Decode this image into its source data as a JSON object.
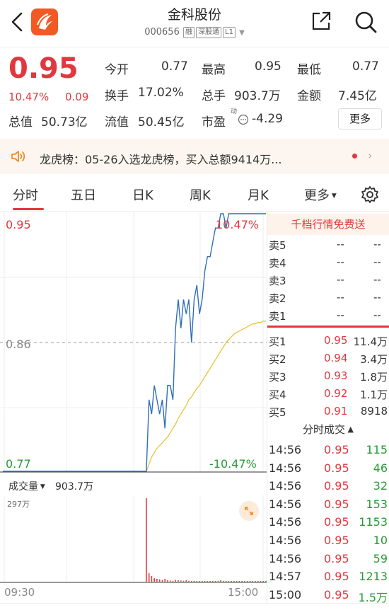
{
  "header": {
    "title": "金科股份",
    "code": "000656",
    "tags": [
      "融",
      "深股通",
      "L1"
    ]
  },
  "quote": {
    "price": "0.95",
    "change_pct": "10.47%",
    "change": "0.09",
    "fields": [
      {
        "label": "今开",
        "value": "0.77",
        "color": "green"
      },
      {
        "label": "最高",
        "value": "0.95",
        "color": "red"
      },
      {
        "label": "最低",
        "value": "0.77",
        "color": "green"
      },
      {
        "label": "换手",
        "value": "17.02%",
        "color": "black"
      },
      {
        "label": "总手",
        "value": "903.7万",
        "color": "black"
      },
      {
        "label": "金额",
        "value": "7.45亿",
        "color": "black"
      },
      {
        "label": "总值",
        "value": "50.73亿",
        "color": "black"
      },
      {
        "label": "流值",
        "value": "50.45亿",
        "color": "black"
      },
      {
        "label": "市盈",
        "value": "-4.29",
        "color": "black",
        "superscript": "动"
      }
    ],
    "more_label": "更多"
  },
  "news": {
    "text": "龙虎榜：05-26入选龙虎榜，买入总额9414万..."
  },
  "tabs": [
    {
      "label": "分时",
      "active": true
    },
    {
      "label": "五日"
    },
    {
      "label": "日K"
    },
    {
      "label": "周K"
    },
    {
      "label": "月K"
    },
    {
      "label": "更多"
    }
  ],
  "chart": {
    "price_top": "0.95",
    "price_mid": "0.86",
    "price_bottom": "0.77",
    "pct_top": "10.47%",
    "pct_bottom": "-10.47%",
    "vol_label": "成交量",
    "vol_value": "903.7万",
    "vol_max": "297万",
    "time_start": "09:30",
    "time_end": "15:00",
    "colors": {
      "price": "#2f6fb8",
      "avg": "#e5c53a",
      "vol": "#e0383e",
      "ref": "#999999"
    }
  },
  "chart_data": {
    "type": "line",
    "xlabel": "",
    "ylabel": "",
    "ylim": [
      0.77,
      0.95
    ],
    "series": [
      {
        "values": [
          0.77,
          0.77,
          0.77,
          0.77,
          0.77,
          0.77,
          0.77,
          0.77,
          0.77,
          0.77,
          0.77,
          0.77,
          0.77,
          0.77,
          0.77,
          0.77,
          0.77,
          0.77,
          0.77,
          0.77,
          0.77,
          0.77,
          0.77,
          0.77,
          0.77,
          0.77,
          0.77,
          0.77,
          0.77,
          0.77,
          0.77,
          0.77,
          0.77,
          0.77,
          0.77,
          0.77,
          0.77,
          0.77,
          0.77,
          0.77,
          0.77,
          0.77,
          0.77,
          0.77,
          0.77,
          0.77,
          0.77,
          0.77,
          0.77,
          0.77,
          0.77,
          0.77,
          0.77,
          0.77,
          0.77,
          0.82,
          0.81,
          0.83,
          0.82,
          0.81,
          0.82,
          0.8,
          0.83,
          0.83,
          0.82,
          0.87,
          0.89,
          0.87,
          0.89,
          0.88,
          0.89,
          0.86,
          0.89,
          0.9,
          0.88,
          0.89,
          0.91,
          0.92,
          0.92,
          0.93,
          0.94,
          0.94,
          0.95,
          0.95,
          0.94,
          0.95,
          0.95,
          0.95,
          0.95,
          0.95,
          0.95,
          0.95,
          0.95,
          0.95,
          0.95,
          0.95,
          0.95,
          0.95,
          0.95,
          0.95
        ]
      },
      {
        "values": [
          null,
          null,
          null,
          null,
          null,
          null,
          null,
          null,
          null,
          null,
          null,
          null,
          null,
          null,
          null,
          null,
          null,
          null,
          null,
          null,
          null,
          null,
          null,
          null,
          null,
          null,
          null,
          null,
          null,
          null,
          null,
          null,
          null,
          null,
          null,
          null,
          null,
          null,
          null,
          null,
          null,
          null,
          null,
          null,
          null,
          null,
          null,
          null,
          null,
          null,
          null,
          null,
          null,
          null,
          0.77,
          0.775,
          0.78,
          0.783,
          0.786,
          0.788,
          0.79,
          0.792,
          0.794,
          0.797,
          0.8,
          0.803,
          0.807,
          0.81,
          0.813,
          0.816,
          0.82,
          0.822,
          0.825,
          0.828,
          0.83,
          0.833,
          0.836,
          0.839,
          0.842,
          0.845,
          0.848,
          0.851,
          0.854,
          0.857,
          0.86,
          0.862,
          0.864,
          0.866,
          0.867,
          0.868,
          0.869,
          0.87,
          0.871,
          0.872,
          0.873,
          0.873,
          0.874,
          0.874,
          0.875,
          0.875
        ]
      }
    ]
  },
  "volume_data": [
    0,
    0,
    0,
    0,
    0,
    0,
    0,
    0,
    0,
    0,
    0,
    0,
    0,
    0,
    0,
    0,
    0,
    0,
    0,
    0,
    0,
    0,
    0,
    0,
    0,
    0,
    0,
    0,
    0,
    0,
    0,
    0,
    0,
    0,
    0,
    0,
    0,
    0,
    0,
    0,
    0,
    0,
    0,
    0,
    0,
    0,
    0,
    0,
    0,
    0,
    0,
    0,
    0,
    0,
    2.97,
    0.3,
    0.2,
    0.12,
    0.1,
    0.08,
    0.06,
    0.1,
    0.05,
    0.04,
    0.03,
    0.06,
    0.05,
    0.04,
    0.03,
    0.05,
    0.03,
    0.02,
    0.03,
    0.02,
    0.02,
    0.03,
    0.02,
    0.02,
    0.02,
    0.02,
    0.02,
    0.03,
    0.05,
    0.02,
    0.02,
    0.02,
    0.02,
    0.02,
    0.02,
    0.02,
    0.02,
    0.02,
    0.02,
    0.02,
    0.02,
    0.02,
    0.02,
    0.02,
    0.02,
    0.02
  ],
  "orderbook": {
    "header": "千档行情免费送",
    "asks": [
      {
        "label": "卖5",
        "price": "--",
        "vol": "--"
      },
      {
        "label": "卖4",
        "price": "--",
        "vol": "--"
      },
      {
        "label": "卖3",
        "price": "--",
        "vol": "--"
      },
      {
        "label": "卖2",
        "price": "--",
        "vol": "--"
      },
      {
        "label": "卖1",
        "price": "--",
        "vol": "--"
      }
    ],
    "bids": [
      {
        "label": "买1",
        "price": "0.95",
        "vol": "11.4万"
      },
      {
        "label": "买2",
        "price": "0.94",
        "vol": "3.4万"
      },
      {
        "label": "买3",
        "price": "0.93",
        "vol": "1.8万"
      },
      {
        "label": "买4",
        "price": "0.92",
        "vol": "1.1万"
      },
      {
        "label": "买5",
        "price": "0.91",
        "vol": "8918"
      }
    ]
  },
  "ticks": {
    "header": "分时成交",
    "rows": [
      {
        "time": "14:56",
        "price": "0.95",
        "vol": "115"
      },
      {
        "time": "14:56",
        "price": "0.95",
        "vol": "46"
      },
      {
        "time": "14:56",
        "price": "0.95",
        "vol": "32"
      },
      {
        "time": "14:56",
        "price": "0.95",
        "vol": "153"
      },
      {
        "time": "14:56",
        "price": "0.95",
        "vol": "1153"
      },
      {
        "time": "14:56",
        "price": "0.95",
        "vol": "10"
      },
      {
        "time": "14:56",
        "price": "0.95",
        "vol": "59"
      },
      {
        "time": "14:57",
        "price": "0.95",
        "vol": "1213"
      },
      {
        "time": "15:00",
        "price": "0.95",
        "vol": "1.5万"
      }
    ]
  }
}
